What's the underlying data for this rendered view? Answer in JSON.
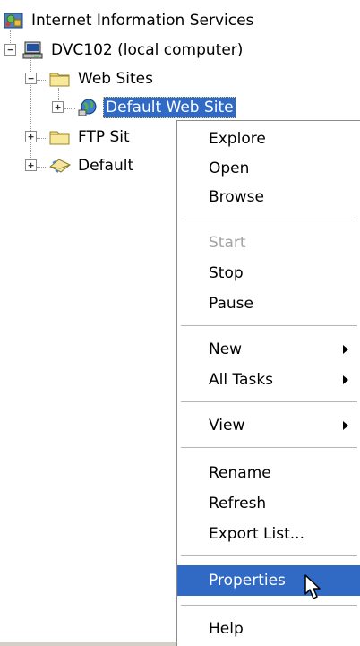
{
  "tree": {
    "root_label": "Internet Information Services",
    "computer_label": "DVC102 (local computer)",
    "web_sites_label": "Web Sites",
    "default_web_site_label": "Default Web Site",
    "ftp_sites_label": "FTP Sit",
    "default_smtp_label": "Default"
  },
  "menu": {
    "explore": "Explore",
    "open": "Open",
    "browse": "Browse",
    "start": "Start",
    "stop": "Stop",
    "pause": "Pause",
    "new": "New",
    "all_tasks": "All Tasks",
    "view": "View",
    "rename": "Rename",
    "refresh": "Refresh",
    "export_list": "Export List...",
    "properties": "Properties",
    "help": "Help"
  },
  "colors": {
    "selection": "#316ac5",
    "disabled_text": "#a3a3a3"
  },
  "icons": {
    "root": "iis-icon",
    "computer": "computer-icon",
    "folder": "folder-icon",
    "web_site": "globe-icon",
    "smtp": "envelope-icon",
    "cursor": "mouse-pointer-icon"
  }
}
